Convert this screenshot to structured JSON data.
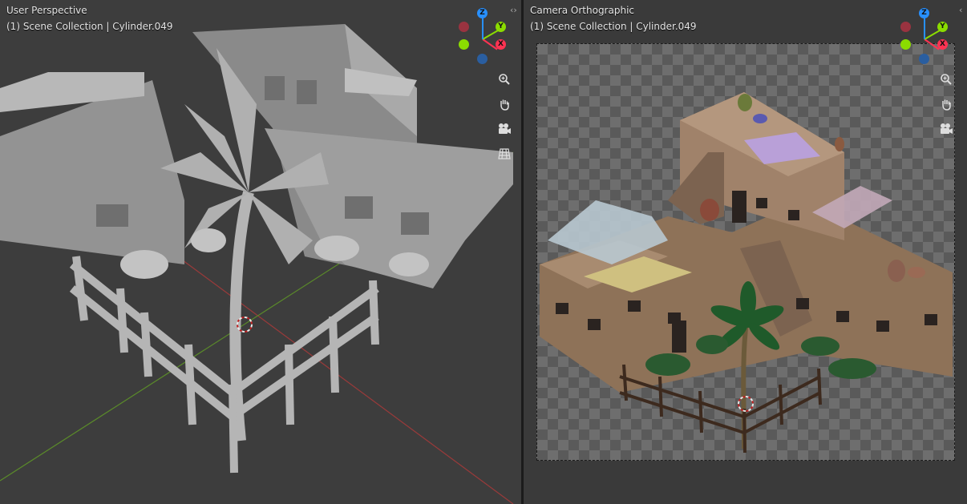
{
  "viewports": [
    {
      "view_name": "User Perspective",
      "collection_line": "(1) Scene Collection | Cylinder.049"
    },
    {
      "view_name": "Camera Orthographic",
      "collection_line": "(1) Scene Collection | Cylinder.049"
    }
  ],
  "gizmo": {
    "z_label": "Z",
    "y_label": "Y",
    "x_label": "X",
    "colors": {
      "x": "#ff3352",
      "y": "#8bdc00",
      "z": "#2890ff",
      "neg_x": "#9a3340",
      "neg_y": "#5a9a1a",
      "neg_z": "#2a5ea0"
    }
  },
  "nav_icons": [
    "zoom-icon",
    "hand-pan-icon",
    "camera-icon",
    "grid-icon"
  ],
  "collapse_glyph": "‹›"
}
